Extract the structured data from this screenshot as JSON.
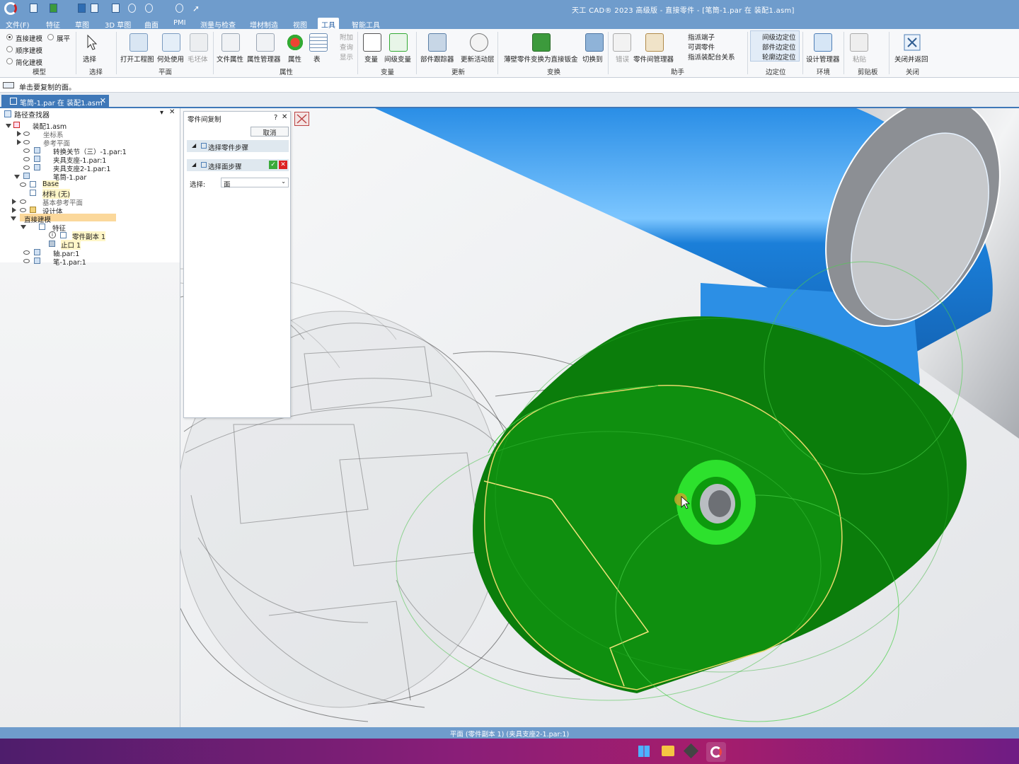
{
  "window": {
    "title": "天工 CAD® 2023 高级版 - 直接零件 - [笔筒-1.par 在 装配1.asm]"
  },
  "menu": [
    "文件(F)",
    "特征",
    "草图",
    "3D 草图",
    "曲面",
    "PMI",
    "测量与检查",
    "增材制造",
    "视图",
    "工具",
    "智能工具"
  ],
  "menu_active": "工具",
  "ribbon": {
    "model_group": {
      "options": [
        "直接建模",
        "顺序建模",
        "简化建模"
      ],
      "expand": "展平",
      "label": "模型"
    },
    "select_group": {
      "button": "选择",
      "label": "选择"
    },
    "plane_group": {
      "buttons": [
        "打开工程图",
        "何处使用",
        "毛坯体"
      ],
      "label": "平面"
    },
    "property_group": {
      "buttons": [
        "文件属性",
        "属性管理器",
        "属性",
        "表"
      ],
      "small": [
        "附加",
        "查询",
        "显示"
      ],
      "label": "属性"
    },
    "variable_group": {
      "buttons": [
        "变量",
        "间级变量"
      ],
      "label": "变量"
    },
    "update_group": {
      "buttons": [
        "部件跟踪器",
        "更新活动层"
      ],
      "label": "更新"
    },
    "convert_group": {
      "buttons": [
        "薄壁零件变换为直接钣金",
        "切换到"
      ],
      "label": "变换"
    },
    "assistant_group": {
      "buttons": [
        "错误",
        "零件间管理器"
      ],
      "small": [
        "指派端子",
        "可调零件",
        "指派装配台关系"
      ],
      "label": "助手"
    },
    "sidebar_group": {
      "items": [
        "间级边定位",
        "部件边定位",
        "轮廓边定位"
      ],
      "label": "边定位"
    },
    "env_group": {
      "button": "设计管理器",
      "label": "环境"
    },
    "clipboard_group": {
      "button": "粘贴",
      "label": "剪贴板"
    },
    "close_group": {
      "button": "关闭并返回",
      "label": "关闭"
    }
  },
  "prompt": "单击要复制的面。",
  "doc_tab": "笔筒-1.par 在 装配1.asm",
  "pathfinder": {
    "title": "路径查找器",
    "tree": [
      {
        "label": "装配1.asm",
        "level": 0
      },
      {
        "label": "坐标系",
        "level": 1
      },
      {
        "label": "参考平面",
        "level": 1
      },
      {
        "label": "转换关节（三）-1.par:1",
        "level": 1
      },
      {
        "label": "夹具支座-1.par:1",
        "level": 1
      },
      {
        "label": "夹具支座2-1.par:1",
        "level": 1
      },
      {
        "label": "笔筒-1.par",
        "level": 1
      },
      {
        "label": "Base",
        "level": 2
      },
      {
        "label": "材料 (无)",
        "level": 2
      },
      {
        "label": "基本参考平面",
        "level": 2
      },
      {
        "label": "设计体",
        "level": 2
      },
      {
        "label": "直接建模",
        "level": 2
      },
      {
        "label": "特征",
        "level": 3
      },
      {
        "label": "零件副本 1",
        "level": 4
      },
      {
        "label": "止口 1",
        "level": 4
      },
      {
        "label": "轴.par:1",
        "level": 1
      },
      {
        "label": "笔-1.par:1",
        "level": 1
      }
    ]
  },
  "dialog": {
    "title": "零件间复制",
    "help": "?",
    "cancel": "取消",
    "step1": "选择零件步骤",
    "step2": "选择面步骤",
    "select_label": "选择:",
    "select_value": "面"
  },
  "status": "平面 (零件副本 1) (夹具支座2-1.par:1)",
  "colors": {
    "accent": "#3f78b8",
    "title_bar": "#6f9ccc",
    "green_part": "#0f8a0f",
    "blue_part": "#1e86e6"
  }
}
